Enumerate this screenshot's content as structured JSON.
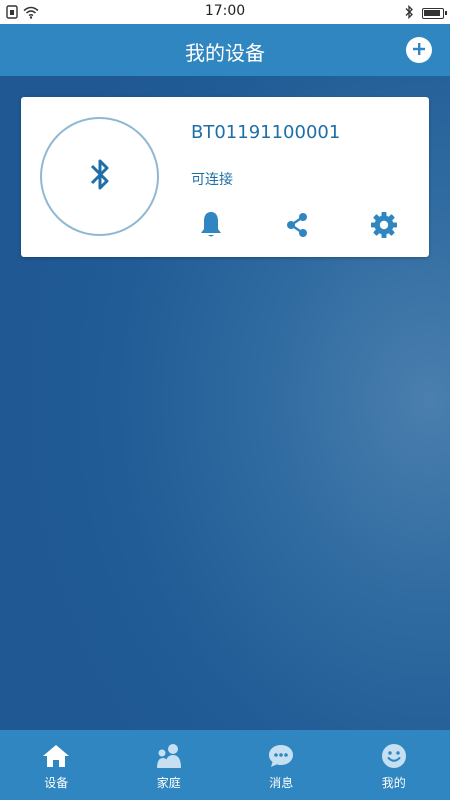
{
  "status_bar": {
    "time": "17:00"
  },
  "header": {
    "title": "我的设备",
    "add_icon": "plus-circle-icon"
  },
  "device": {
    "id": "BT01191100001",
    "status": "可连接",
    "icon": "bluetooth-icon",
    "actions": [
      "bell-icon",
      "share-icon",
      "gear-icon"
    ]
  },
  "tabs": [
    {
      "label": "设备",
      "icon": "home-icon",
      "active": true
    },
    {
      "label": "家庭",
      "icon": "family-icon",
      "active": false
    },
    {
      "label": "消息",
      "icon": "chat-icon",
      "active": false
    },
    {
      "label": "我的",
      "icon": "smiley-icon",
      "active": false
    }
  ],
  "colors": {
    "primary": "#2f86c1",
    "accent_text": "#1e6fa8",
    "tab_icon_inactive": "#c6e0f2",
    "background": "#215c96"
  }
}
